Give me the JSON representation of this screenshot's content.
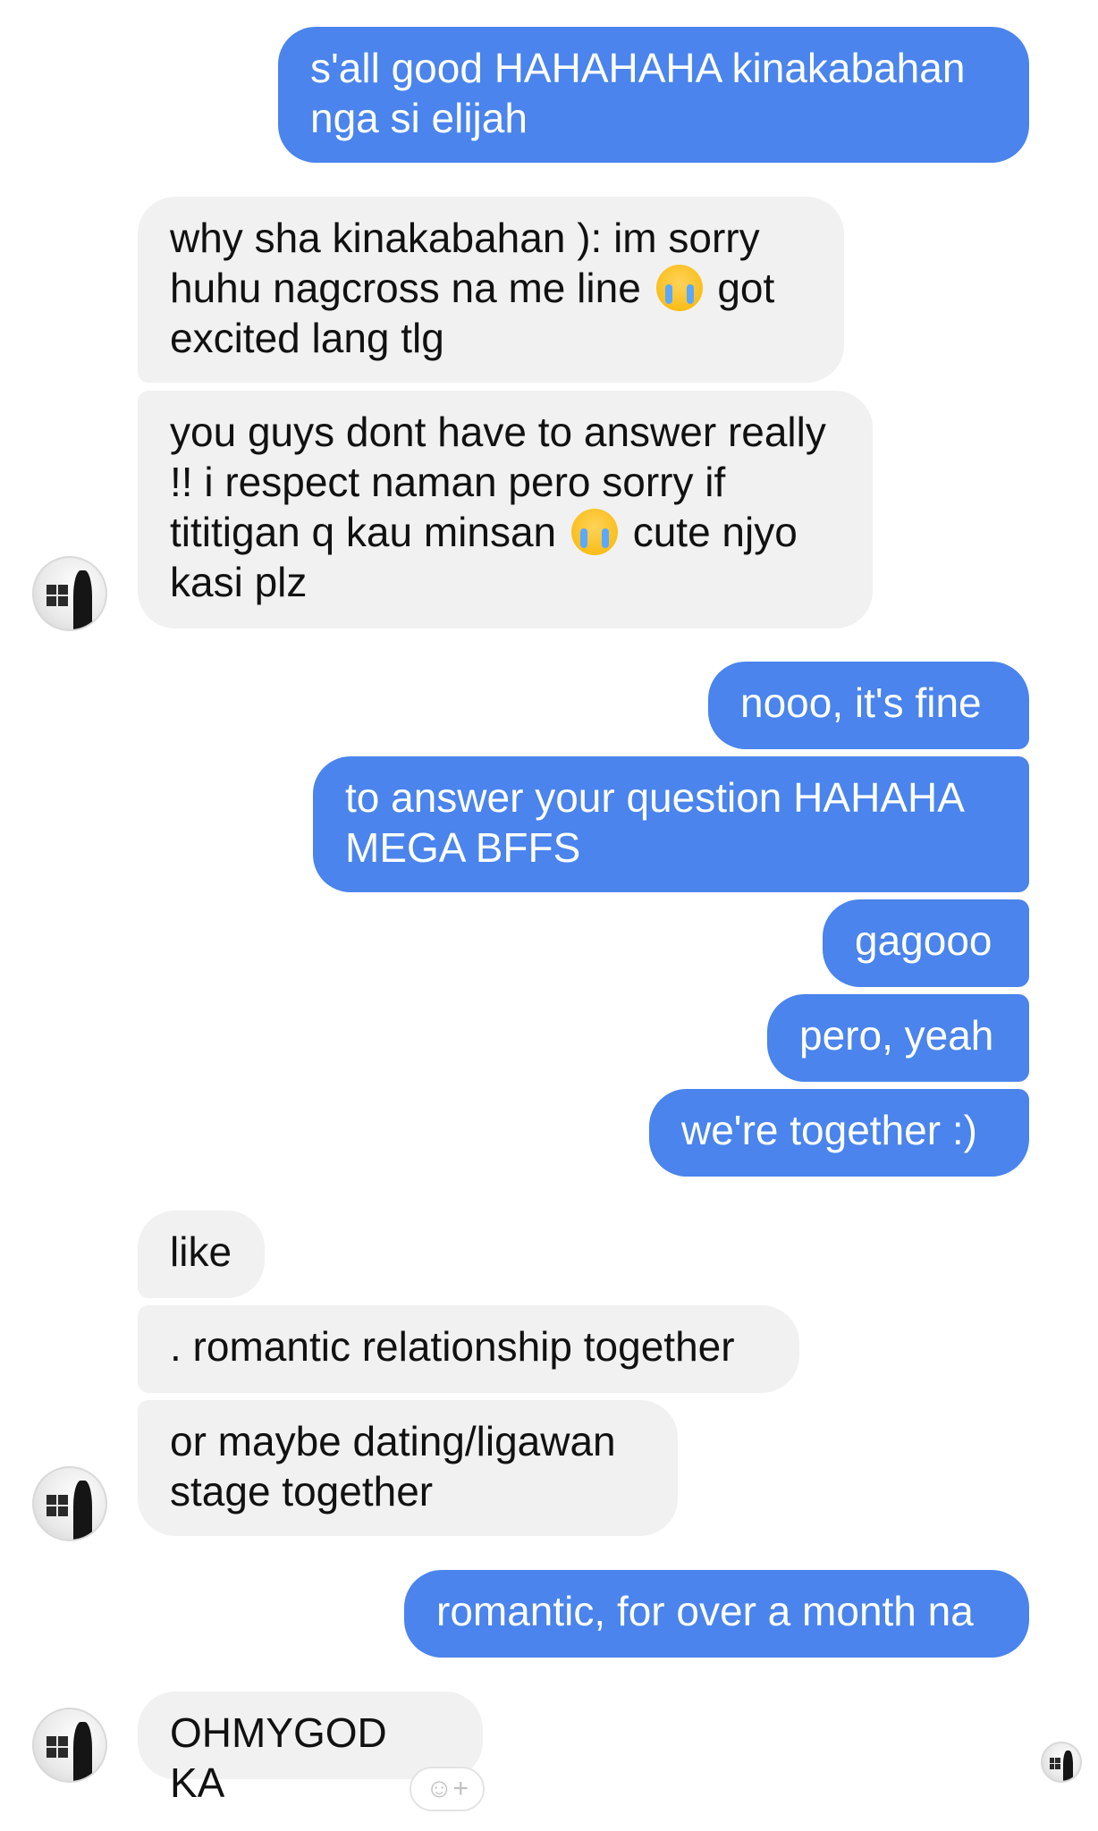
{
  "messages": [
    {
      "id": "m1",
      "side": "out",
      "text": "s'all good HAHAHAHA kinakabahan nga si elijah"
    },
    {
      "id": "m2",
      "side": "in",
      "parts": [
        "why sha kinakabahan ): im sorry huhu nagcross na me line",
        "got excited lang tlg"
      ],
      "emoji": "crying-face-emoji"
    },
    {
      "id": "m3",
      "side": "in",
      "parts": [
        "you guys dont have to answer really !! i respect naman pero sorry if tititigan q kau minsan",
        "cute njyo kasi plz"
      ],
      "emoji": "crying-face-emoji"
    },
    {
      "id": "m4",
      "side": "out",
      "text": "nooo, it's fine"
    },
    {
      "id": "m5",
      "side": "out",
      "text": "to answer your question HAHAHA MEGA BFFS"
    },
    {
      "id": "m6",
      "side": "out",
      "text": "gagooo"
    },
    {
      "id": "m7",
      "side": "out",
      "text": "pero, yeah"
    },
    {
      "id": "m8",
      "side": "out",
      "text": "we're together :)"
    },
    {
      "id": "m9",
      "side": "in",
      "text": "like"
    },
    {
      "id": "m10",
      "side": "in",
      "text": ". romantic relationship together"
    },
    {
      "id": "m11",
      "side": "in",
      "text": "or maybe dating/ligawan stage together"
    },
    {
      "id": "m12",
      "side": "out",
      "text": "romantic, for over a month na"
    },
    {
      "id": "m13",
      "side": "in",
      "text": "OHMYGOD KA"
    }
  ],
  "reaction_button": {
    "icon": "add-reaction-icon",
    "glyph": "☺+"
  },
  "colors": {
    "outgoing": "#4a84ec",
    "incoming": "#f1f1f1"
  }
}
